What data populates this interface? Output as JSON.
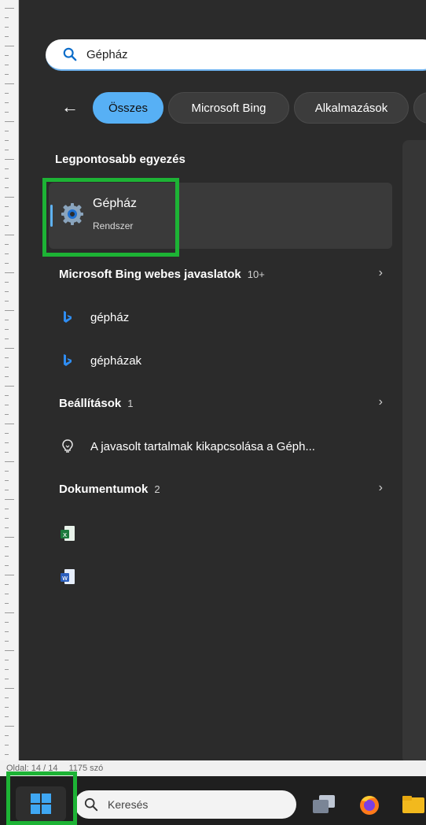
{
  "search": {
    "query": "Gépház"
  },
  "filters": {
    "back_label": "←",
    "items": [
      {
        "label": "Összes",
        "active": true
      },
      {
        "label": "Microsoft Bing",
        "active": false
      },
      {
        "label": "Alkalmazások",
        "active": false
      }
    ]
  },
  "best_match": {
    "title": "Legpontosabb egyezés",
    "name": "Gépház",
    "kind": "Rendszer",
    "icon": "gear-icon"
  },
  "bing_section": {
    "title": "Microsoft Bing webes javaslatok",
    "count": "10+",
    "items": [
      {
        "label": "gépház",
        "icon": "bing-icon"
      },
      {
        "label": "gépházak",
        "icon": "bing-icon"
      }
    ]
  },
  "settings_section": {
    "title": "Beállítások",
    "count": "1",
    "items": [
      {
        "label": "A javasolt tartalmak kikapcsolása a Géph...",
        "icon": "lightbulb-icon"
      }
    ]
  },
  "documents_section": {
    "title": "Dokumentumok",
    "count": "2",
    "items": [
      {
        "icon": "excel-file-icon"
      },
      {
        "icon": "word-file-icon"
      }
    ]
  },
  "word_status": {
    "page": "Oldal: 14 / 14",
    "words": "1175 szó"
  },
  "taskbar": {
    "search_placeholder": "Keresés"
  },
  "colors": {
    "accent": "#57b0f5",
    "highlight": "#1db335",
    "panel": "#2b2b2b"
  }
}
